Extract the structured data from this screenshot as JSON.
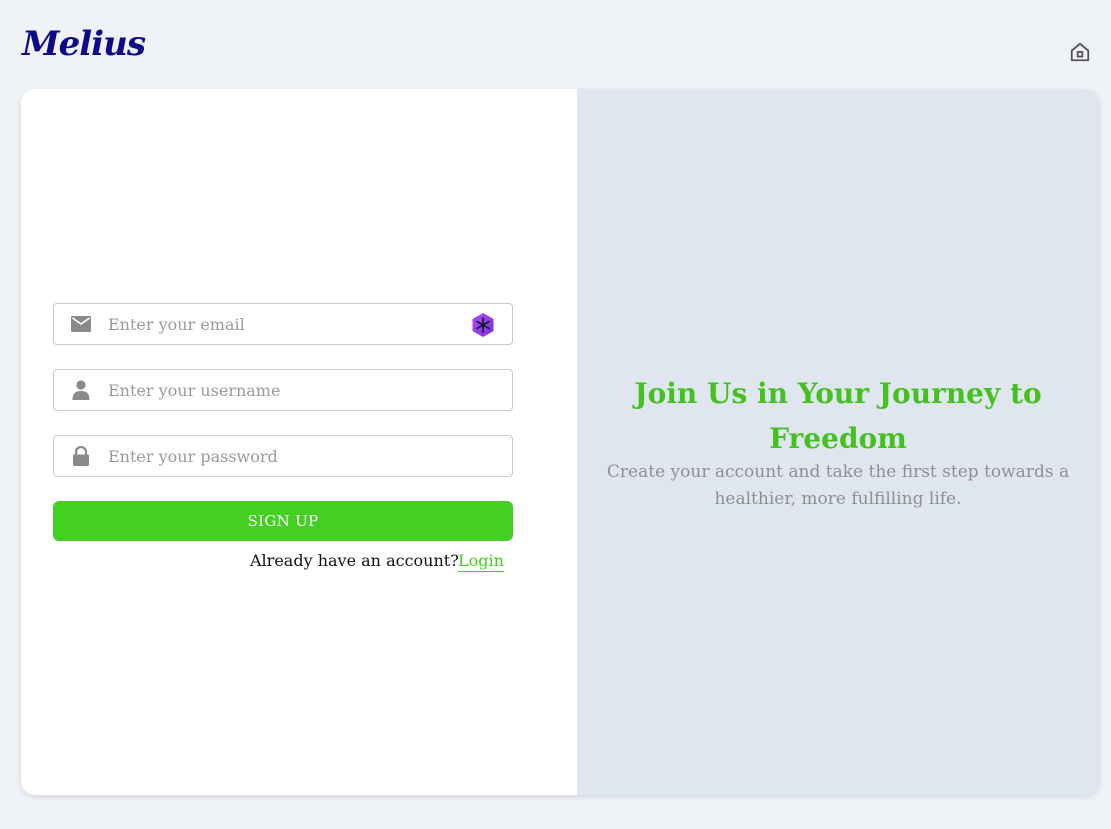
{
  "header": {
    "logo_text": "Melius",
    "home_icon": "home-icon"
  },
  "form": {
    "email": {
      "placeholder": "Enter your email",
      "value": "",
      "icon": "mail-icon",
      "extension_icon": "extension-badge-icon"
    },
    "username": {
      "placeholder": "Enter your username",
      "value": "",
      "icon": "user-icon"
    },
    "password": {
      "placeholder": "Enter your password",
      "value": "",
      "icon": "lock-icon"
    },
    "signup_label": "SIGN UP",
    "account_prompt": "Already have an account?",
    "login_label": "Login"
  },
  "hero": {
    "title": "Join Us in Your Journey to Freedom",
    "subtitle": "Create your account and take the first step towards a healthier, more fulfilling life."
  },
  "colors": {
    "page_bg": "#eff2f7",
    "brand": "#0d0a8a",
    "accent_green": "#44d021",
    "title_green": "#44c11f",
    "right_panel_bg": "#e0e6f0",
    "muted_text": "#8f8f8f"
  }
}
